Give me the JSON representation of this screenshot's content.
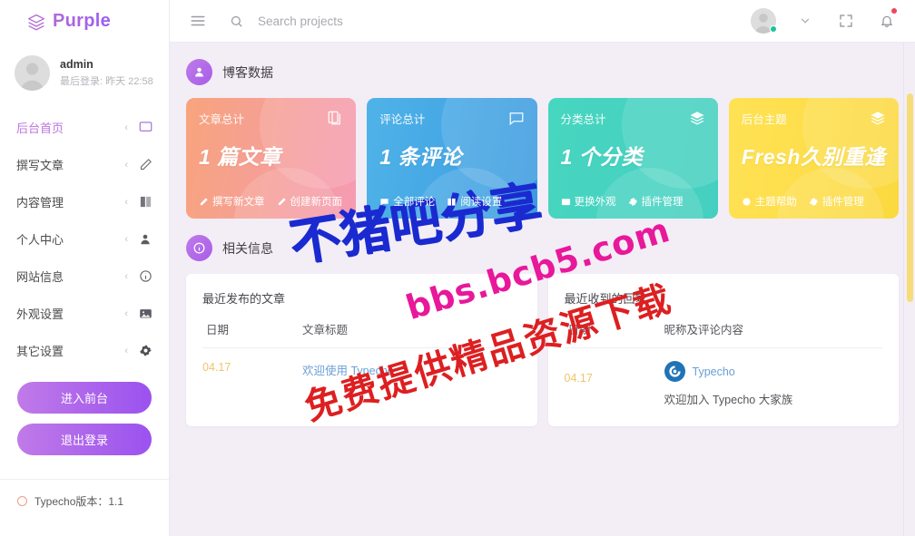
{
  "brand": {
    "name": "Purple",
    "icon": "layers-icon"
  },
  "sidebar": {
    "user": {
      "name": "admin",
      "last_login": "最后登录: 昨天 22:58",
      "avatar": "user-avatar"
    },
    "items": [
      {
        "label": "后台首页",
        "icon": "monitor-icon",
        "caret": "‹",
        "active": true
      },
      {
        "label": "撰写文章",
        "icon": "pencil-icon",
        "caret": "‹",
        "active": false
      },
      {
        "label": "内容管理",
        "icon": "book-icon",
        "caret": "‹",
        "active": false
      },
      {
        "label": "个人中心",
        "icon": "user-icon",
        "caret": "‹",
        "active": false
      },
      {
        "label": "网站信息",
        "icon": "info-icon",
        "caret": "‹",
        "active": false
      },
      {
        "label": "外观设置",
        "icon": "image-icon",
        "caret": "‹",
        "active": false
      },
      {
        "label": "其它设置",
        "icon": "gear-icon",
        "caret": "‹",
        "active": false
      }
    ],
    "buttons": {
      "front": "进入前台",
      "logout": "退出登录"
    },
    "version": "Typecho版本：1.1"
  },
  "topbar": {
    "menu_icon": "hamburger-icon",
    "search": {
      "icon": "search-icon",
      "placeholder": "Search projects",
      "value": ""
    },
    "chevron": "chevron-down-icon",
    "fullscreen": "fullscreen-icon",
    "bell": "bell-icon"
  },
  "sections": {
    "blog_data": {
      "title": "博客数据",
      "icon": "user-circle-icon"
    },
    "related_info": {
      "title": "相关信息",
      "icon": "info-circle-icon"
    }
  },
  "cards": [
    {
      "label": "文章总计",
      "value": "1 篇文章",
      "icon": "article-icon",
      "color": "#f7a47d",
      "links": [
        {
          "label": "撰写新文章",
          "icon": "pencil-icon"
        },
        {
          "label": "创建新页面",
          "icon": "pencil-icon"
        }
      ]
    },
    {
      "label": "评论总计",
      "value": "1 条评论",
      "icon": "comment-icon",
      "color": "#4fb3e8",
      "links": [
        {
          "label": "全部评论",
          "icon": "comment-icon"
        },
        {
          "label": "阅读设置",
          "icon": "book-icon"
        }
      ]
    },
    {
      "label": "分类总计",
      "value": "1 个分类",
      "icon": "layers-icon",
      "color": "#47d6c0",
      "links": [
        {
          "label": "更换外观",
          "icon": "image-icon"
        },
        {
          "label": "插件管理",
          "icon": "gear-icon"
        }
      ]
    },
    {
      "label": "后台主题",
      "value": "Fresh久别重逢",
      "icon": "layers-icon",
      "color": "#ffe255",
      "links": [
        {
          "label": "主题帮助",
          "icon": "dot-icon"
        },
        {
          "label": "插件管理",
          "icon": "gear-icon"
        }
      ]
    }
  ],
  "panels": {
    "recent_posts": {
      "title": "最近发布的文章",
      "columns": [
        "日期",
        "文章标题"
      ],
      "rows": [
        {
          "date": "04.17",
          "title": "欢迎使用 Typecho"
        }
      ]
    },
    "recent_comments": {
      "title": "最近收到的回复",
      "columns": [
        "日期",
        "昵称及评论内容"
      ],
      "rows": [
        {
          "date": "04.17",
          "author": "Typecho",
          "text": "欢迎加入 Typecho 大家族",
          "avatar": "typecho-logo-icon"
        }
      ]
    }
  },
  "watermarks": {
    "blue": "不猪吧分享",
    "pink": "bbs.bcb5.com",
    "red": "免费提供精品资源下载"
  }
}
